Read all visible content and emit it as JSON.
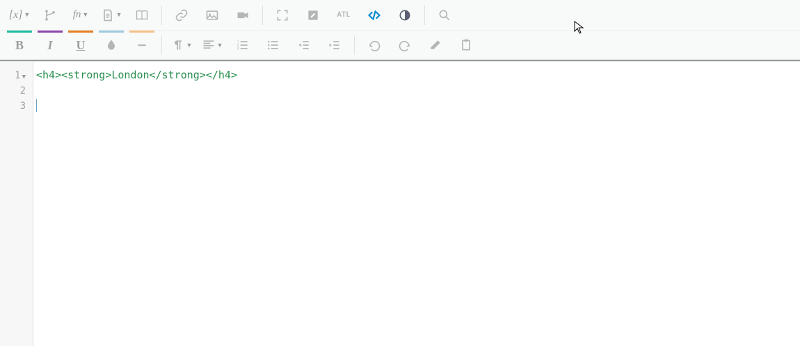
{
  "toolbar_row1": {
    "variable": "[x]",
    "function": "fn",
    "atl": "ATL"
  },
  "toolbar_row2": {
    "bold": "B",
    "italic": "I",
    "underline": "U"
  },
  "editor": {
    "lines": {
      "n1": "1",
      "n2": "2",
      "n3": "3",
      "code1": "<h4><strong>London</strong></h4>"
    }
  }
}
